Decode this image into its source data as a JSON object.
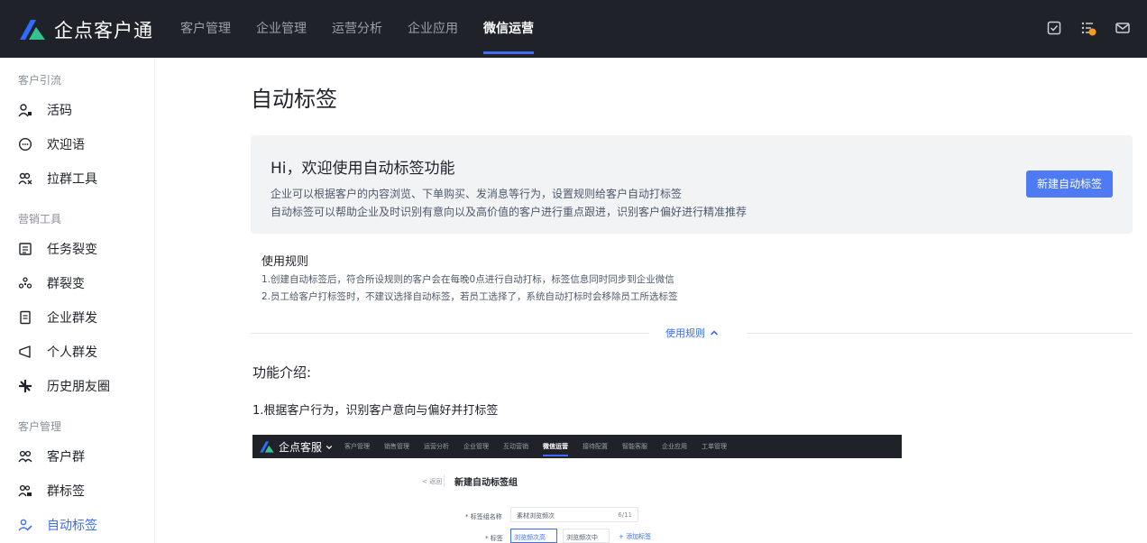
{
  "app": {
    "logo_text": "企点客户通"
  },
  "nav": {
    "items": [
      {
        "label": "客户管理"
      },
      {
        "label": "企业管理"
      },
      {
        "label": "运营分析"
      },
      {
        "label": "企业应用"
      },
      {
        "label": "微信运营"
      }
    ]
  },
  "sidebar": {
    "groups": [
      {
        "title": "客户引流",
        "items": [
          {
            "label": "活码"
          },
          {
            "label": "欢迎语"
          },
          {
            "label": "拉群工具"
          }
        ]
      },
      {
        "title": "营销工具",
        "items": [
          {
            "label": "任务裂变"
          },
          {
            "label": "群裂变"
          },
          {
            "label": "企业群发"
          },
          {
            "label": "个人群发"
          },
          {
            "label": "历史朋友圈"
          }
        ]
      },
      {
        "title": "客户管理",
        "items": [
          {
            "label": "客户群"
          },
          {
            "label": "群标签"
          },
          {
            "label": "自动标签"
          }
        ]
      }
    ]
  },
  "main": {
    "title": "自动标签",
    "banner": {
      "title": "Hi，欢迎使用自动标签功能",
      "desc1": "企业可以根据客户的内容浏览、下单购买、发消息等行为，设置规则给客户自动打标签",
      "desc2": "自动标签可以帮助企业及时识别有意向以及高价值的客户进行重点跟进，识别客户偏好进行精准推荐",
      "button": "新建自动标签"
    },
    "rules": {
      "title": "使用规则",
      "rule1": "1.创建自动标签后，符合所设规则的客户会在每晚0点进行自动打标，标签信息同时同步到企业微信",
      "rule2": "2.员工给客户打标签时，不建议选择自动标签，若员工选择了，系统自动打标时会移除员工所选标签",
      "toggle": "使用规则"
    },
    "feature": {
      "title": "功能介绍:",
      "item1": "1.根据客户行为，识别客户意向与偏好并打标签"
    }
  },
  "screenshot": {
    "logo_text": "企点客服",
    "nav": [
      "客户管理",
      "销售管理",
      "运营分析",
      "企业管理",
      "互动营销",
      "微信运营",
      "接待配置",
      "智能客服",
      "企业应用",
      "工单管理"
    ],
    "back": "< 返回",
    "title": "新建自动标签组",
    "label_name": "* 标签组名称",
    "input_value": "素材浏览频次",
    "input_count": "6/11",
    "label_tag": "* 标签",
    "tag1": "浏览频次高",
    "tag2": "浏览频次中",
    "add_tag": "+ 添加标签"
  },
  "colors": {
    "accent": "#3d6cf5",
    "topbar": "#1f2329",
    "banner_bg": "#f2f3f5"
  }
}
